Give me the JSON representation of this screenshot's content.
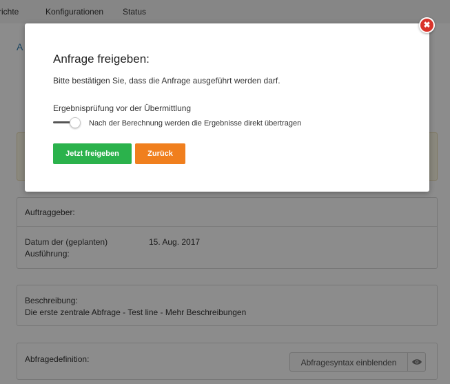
{
  "nav": {
    "items": [
      "richte",
      "Konfigurationen",
      "Status"
    ]
  },
  "background_title": "A",
  "auftrag": {
    "auftraggeber_label": "Auftraggeber:",
    "datum_label_line1": "Datum der (geplanten)",
    "datum_label_line2": "Ausführung:",
    "datum_value": "15. Aug. 2017"
  },
  "beschreibung": {
    "label": "Beschreibung:",
    "value": "Die erste zentrale Abfrage - Test line - Mehr Beschreibungen"
  },
  "abfragedefinition": {
    "label": "Abfragedefinition:",
    "syntax_button": "Abfragesyntax einblenden",
    "eye_icon": "eye-icon"
  },
  "modal": {
    "title": "Anfrage freigeben:",
    "text": "Bitte bestätigen Sie, dass die Anfrage ausgeführt werden darf.",
    "toggle_label": "Ergebnisprüfung vor der Übermittlung",
    "toggle_on": false,
    "toggle_desc": "Nach der Berechnung werden die Ergebnisse direkt übertragen",
    "confirm_button": "Jetzt freigeben",
    "back_button": "Zurück",
    "close_icon": "close-icon"
  },
  "colors": {
    "confirm": "#2bb24c",
    "back": "#f07f1e",
    "close": "#d9342b",
    "link": "#2a7ab0"
  }
}
